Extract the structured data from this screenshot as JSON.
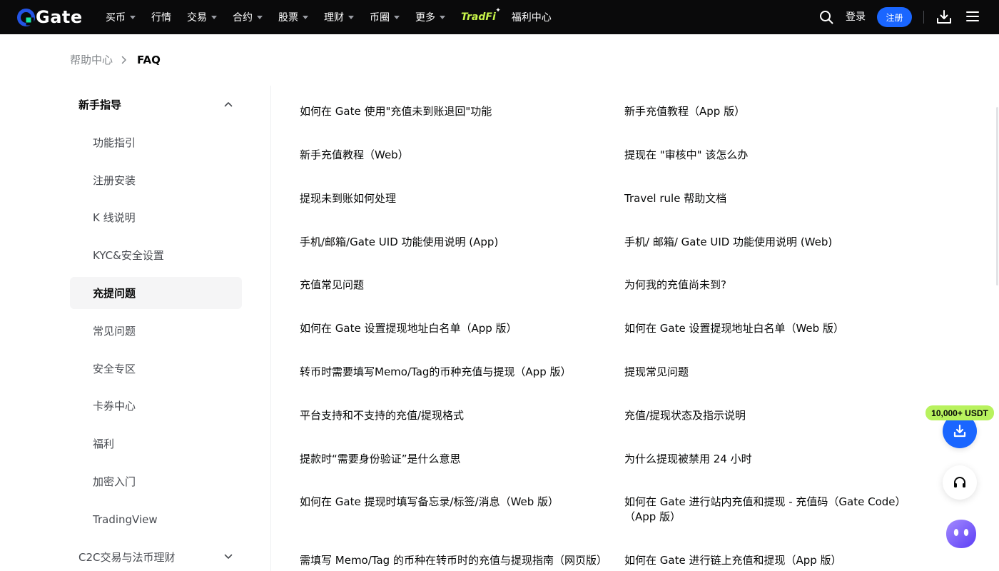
{
  "header": {
    "logo_text": "Gate",
    "nav": [
      {
        "label": "买币",
        "dropdown": true
      },
      {
        "label": "行情",
        "dropdown": false
      },
      {
        "label": "交易",
        "dropdown": true
      },
      {
        "label": "合约",
        "dropdown": true
      },
      {
        "label": "股票",
        "dropdown": true
      },
      {
        "label": "理财",
        "dropdown": true
      },
      {
        "label": "币圈",
        "dropdown": true
      },
      {
        "label": "更多",
        "dropdown": true
      }
    ],
    "tradfi_label": "TradFi",
    "welfare_label": "福利中心",
    "login_label": "登录",
    "register_label": "注册",
    "accent_color": "#1a66ff",
    "icons": [
      "search-icon",
      "download-icon",
      "menu-icon"
    ]
  },
  "breadcrumb": {
    "home": "帮助中心",
    "current": "FAQ"
  },
  "sidebar": {
    "group1": "新手指导",
    "items": [
      {
        "label": "功能指引",
        "active": false
      },
      {
        "label": "注册安装",
        "active": false
      },
      {
        "label": "K 线说明",
        "active": false
      },
      {
        "label": "KYC&安全设置",
        "active": false
      },
      {
        "label": "充提问题",
        "active": true
      },
      {
        "label": "常见问题",
        "active": false
      },
      {
        "label": "安全专区",
        "active": false
      },
      {
        "label": "卡券中心",
        "active": false
      },
      {
        "label": "福利",
        "active": false
      },
      {
        "label": "加密入门",
        "active": false
      },
      {
        "label": "TradingView",
        "active": false
      }
    ],
    "group2": "C2C交易与法币理财"
  },
  "faq": {
    "rows": [
      [
        "如何在 Gate 使用\"充值未到账退回\"功能",
        "新手充值教程（App 版）"
      ],
      [
        "新手充值教程（Web）",
        "提现在 \"审核中\" 该怎么办"
      ],
      [
        "提现未到账如何处理",
        "Travel rule 帮助文档"
      ],
      [
        "手机/邮箱/Gate UID 功能使用说明 (App)",
        "手机/ 邮箱/ Gate UID 功能使用说明 (Web)"
      ],
      [
        "充值常见问题",
        "为何我的充值尚未到?"
      ],
      [
        "如何在 Gate 设置提现地址白名单（App 版）",
        "如何在 Gate 设置提现地址白名单（Web 版）"
      ],
      [
        "转币时需要填写Memo/Tag的币种充值与提现（App 版）",
        "提现常见问题"
      ],
      [
        "平台支持和不支持的充值/提现格式",
        "充值/提现状态及指示说明"
      ],
      [
        "提款时“需要身份验证”是什么意思",
        "为什么提现被禁用 24 小时"
      ],
      [
        "如何在 Gate 提现时填写备忘录/标签/消息（Web 版）",
        "如何在 Gate 进行站内充值和提现 - 充值码（Gate Code）（App 版）"
      ],
      [
        "需填写 Memo/Tag 的币种在转币时的充值与提现指南（网页版）",
        "如何在 Gate 进行链上充值和提现（App 版）"
      ]
    ]
  },
  "floating": {
    "promo": "10,000+ USDT",
    "promo_color": "#b8f25e"
  }
}
